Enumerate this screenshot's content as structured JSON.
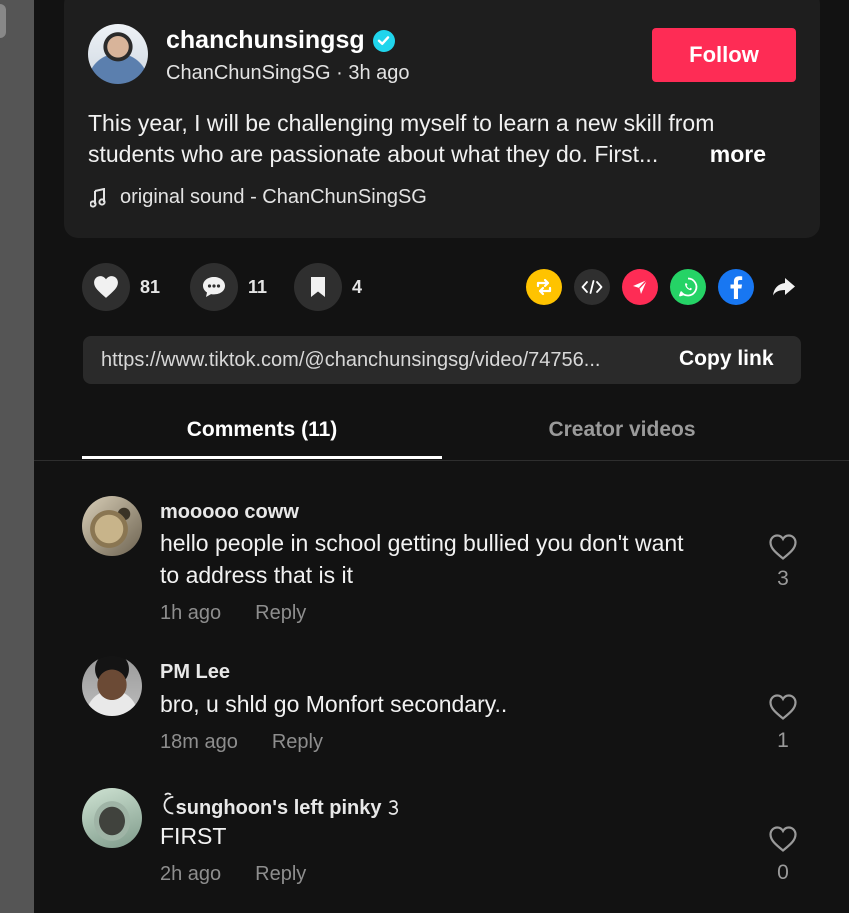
{
  "post": {
    "username": "chanchunsingsg",
    "handle": "ChanChunSingSG",
    "separator": "·",
    "time": "3h ago",
    "follow_label": "Follow",
    "caption_line1": "This year, I will be challenging myself to learn a new skill from",
    "caption_line2": "students who are passionate about what they do. First...",
    "more_label": "more",
    "sound": "original sound - ChanChunSingSG"
  },
  "actions": {
    "likes": "81",
    "comments": "11",
    "saves": "4"
  },
  "share_icons": [
    "repost-icon",
    "embed-icon",
    "send-icon",
    "whatsapp-icon",
    "facebook-icon",
    "share-arrow-icon"
  ],
  "link": {
    "url": "https://www.tiktok.com/@chanchunsingsg/video/74756...",
    "copy_label": "Copy link"
  },
  "tabs": {
    "comments": "Comments (11)",
    "creator_videos": "Creator videos"
  },
  "comments": [
    {
      "user": "mooooo coww",
      "text1": "hello people in school getting bullied you don't want",
      "text2": "to address that is it",
      "time": "1h ago",
      "reply": "Reply",
      "likes": "3"
    },
    {
      "user": "PM Lee",
      "text1": "bro, u shld go Monfort secondary..",
      "text2": "",
      "time": "18m ago",
      "reply": "Reply",
      "likes": "1"
    },
    {
      "user": "ꉓsunghoon's left pinky 𝟹",
      "text1": "FIRST",
      "text2": "",
      "time": "2h ago",
      "reply": "Reply",
      "likes": "0"
    }
  ],
  "colors": {
    "accent": "#fe2c55",
    "verified": "#20d5ec",
    "repost": "#ffc300",
    "whatsapp": "#25d366",
    "facebook": "#1877f2"
  }
}
